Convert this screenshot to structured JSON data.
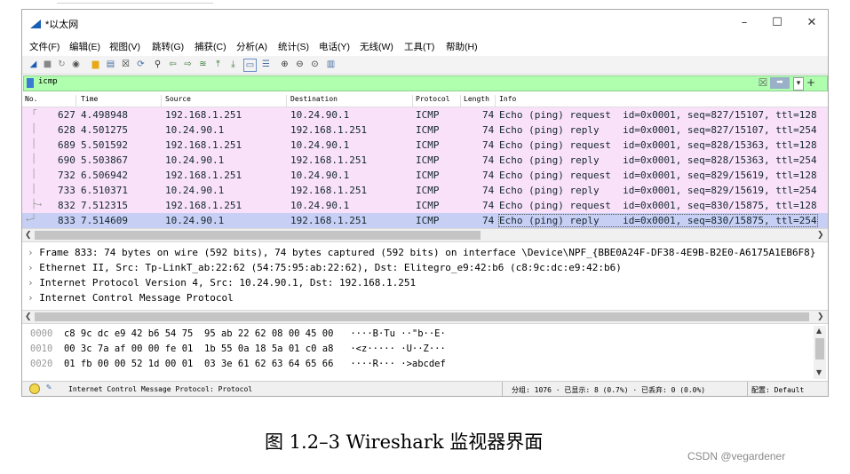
{
  "window": {
    "title": "*以太网",
    "min": "–",
    "max": "☐",
    "close": "✕"
  },
  "menu": [
    "文件(F)",
    "编辑(E)",
    "视图(V)",
    "跳转(G)",
    "捕获(C)",
    "分析(A)",
    "统计(S)",
    "电话(Y)",
    "无线(W)",
    "工具(T)",
    "帮助(H)"
  ],
  "toolbar_icons": [
    "shark-fin-start-icon",
    "stop-icon",
    "restart-icon",
    "options-icon",
    "open-file-icon",
    "save-icon",
    "close-file-icon",
    "reload-icon",
    "find-icon",
    "go-back-icon",
    "go-forward-icon",
    "go-to-packet-icon",
    "first-packet-icon",
    "last-packet-icon",
    "autoscroll-icon",
    "colorize-icon",
    "zoom-in-icon",
    "zoom-out-icon",
    "zoom-reset-icon",
    "resize-columns-icon"
  ],
  "filter": {
    "value": "icmp",
    "clear": "☒",
    "apply": "➡",
    "dropdown": "▾",
    "add": "+",
    "color": "#afffaf"
  },
  "columns": {
    "no": "No.",
    "time": "Time",
    "source": "Source",
    "destination": "Destination",
    "protocol": "Protocol",
    "length": "Length",
    "info": "Info"
  },
  "packets": [
    {
      "no": "627",
      "time": "4.498948",
      "src": "192.168.1.251",
      "dst": "10.24.90.1",
      "proto": "ICMP",
      "len": "74",
      "info": "Echo (ping) request  id=0x0001, seq=827/15107, ttl=128"
    },
    {
      "no": "628",
      "time": "4.501275",
      "src": "10.24.90.1",
      "dst": "192.168.1.251",
      "proto": "ICMP",
      "len": "74",
      "info": "Echo (ping) reply    id=0x0001, seq=827/15107, ttl=254"
    },
    {
      "no": "689",
      "time": "5.501592",
      "src": "192.168.1.251",
      "dst": "10.24.90.1",
      "proto": "ICMP",
      "len": "74",
      "info": "Echo (ping) request  id=0x0001, seq=828/15363, ttl=128"
    },
    {
      "no": "690",
      "time": "5.503867",
      "src": "10.24.90.1",
      "dst": "192.168.1.251",
      "proto": "ICMP",
      "len": "74",
      "info": "Echo (ping) reply    id=0x0001, seq=828/15363, ttl=254"
    },
    {
      "no": "732",
      "time": "6.506942",
      "src": "192.168.1.251",
      "dst": "10.24.90.1",
      "proto": "ICMP",
      "len": "74",
      "info": "Echo (ping) request  id=0x0001, seq=829/15619, ttl=128"
    },
    {
      "no": "733",
      "time": "6.510371",
      "src": "10.24.90.1",
      "dst": "192.168.1.251",
      "proto": "ICMP",
      "len": "74",
      "info": "Echo (ping) reply    id=0x0001, seq=829/15619, ttl=254"
    },
    {
      "no": "832",
      "time": "7.512315",
      "src": "192.168.1.251",
      "dst": "10.24.90.1",
      "proto": "ICMP",
      "len": "74",
      "info": "Echo (ping) request  id=0x0001, seq=830/15875, ttl=128"
    },
    {
      "no": "833",
      "time": "7.514609",
      "src": "10.24.90.1",
      "dst": "192.168.1.251",
      "proto": "ICMP",
      "len": "74",
      "info": "Echo (ping) reply    id=0x0001, seq=830/15875, ttl=254"
    }
  ],
  "row_colors": {
    "icmp": "#fae1fa",
    "selected": "#c7cff5"
  },
  "details": [
    "Frame 833: 74 bytes on wire (592 bits), 74 bytes captured (592 bits) on interface \\Device\\NPF_{BBE0A24F-DF38-4E9B-B2E0-A6175A1EB6F8}",
    "Ethernet II, Src: Tp-LinkT_ab:22:62 (54:75:95:ab:22:62), Dst: Elitegro_e9:42:b6 (c8:9c:dc:e9:42:b6)",
    "Internet Protocol Version 4, Src: 10.24.90.1, Dst: 192.168.1.251",
    "Internet Control Message Protocol"
  ],
  "hexdump": [
    {
      "off": "0000",
      "hex": "c8 9c dc e9 42 b6 54 75  95 ab 22 62 08 00 45 00",
      "ascii": "····B·Tu ··\"b··E·"
    },
    {
      "off": "0010",
      "hex": "00 3c 7a af 00 00 fe 01  1b 55 0a 18 5a 01 c0 a8",
      "ascii": "·<z····· ·U··Z···"
    },
    {
      "off": "0020",
      "hex": "01 fb 00 00 52 1d 00 01  03 3e 61 62 63 64 65 66",
      "ascii": "····R··· ·>abcdef"
    }
  ],
  "status": {
    "field": "Internet Control Message Protocol: Protocol",
    "counts": "分组: 1076 · 已显示: 8 (0.7%) · 已丢弃: 0 (0.0%)",
    "profile": "配置: Default"
  },
  "caption": "图 1.2–3 Wireshark 监视器界面",
  "credit": "CSDN @vegardener"
}
